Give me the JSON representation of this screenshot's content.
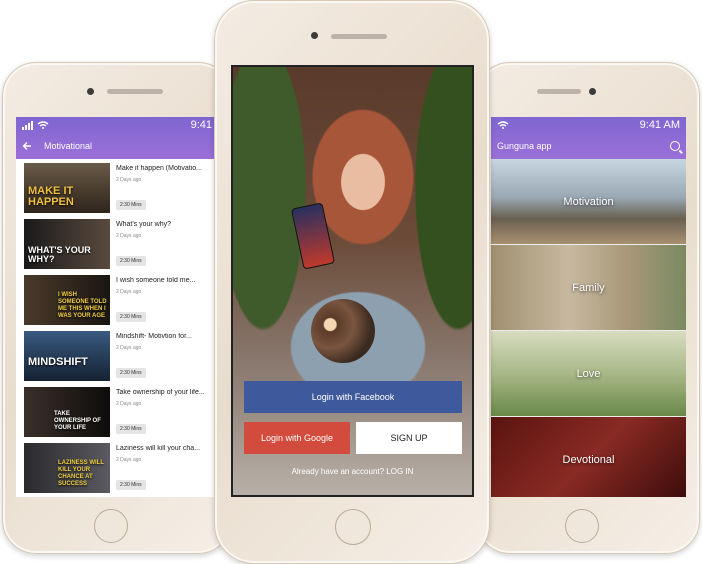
{
  "left_phone": {
    "status": {
      "time": "9:41"
    },
    "header": {
      "title": "Motivational"
    },
    "videos": [
      {
        "thumb_text": "MAKE IT HAPPEN",
        "title": "Make it happen (Motivatio...",
        "date": "2 Days ago",
        "duration": "2:30 Mins",
        "thumb_color": "#4a3a2a"
      },
      {
        "thumb_text": "WHAT'S YOUR WHY?",
        "title": "What's your why?",
        "date": "2 Days ago",
        "duration": "2:30 Mins",
        "thumb_color": "#2a2a2a"
      },
      {
        "thumb_text": "I WISH SOMEONE TOLD ME THIS WHEN I WAS YOUR AGE",
        "title": "I wish someone told me...",
        "date": "2 Days ago",
        "duration": "2:30 Mins",
        "thumb_color": "#3a2e22"
      },
      {
        "thumb_text": "MINDSHIFT",
        "title": "Mindshift- Motivtion for...",
        "date": "2 Days ago",
        "duration": "2:30 Mins",
        "thumb_color": "#1f3a5a"
      },
      {
        "thumb_text": "TAKE OWNERSHIP OF YOUR LIFE",
        "title": "Take ownership of your life...",
        "date": "2 Days ago",
        "duration": "2:30 Mins",
        "thumb_color": "#2c2420"
      },
      {
        "thumb_text": "LAZINESS WILL KILL YOUR CHANCE AT SUCCESS",
        "title": "Laziness will kill your cha...",
        "date": "2 Days ago",
        "duration": "2:30 Mins",
        "thumb_color": "#2a2a30"
      }
    ]
  },
  "center_phone": {
    "buttons": {
      "facebook": "Login with Facebook",
      "google": "Login with Google",
      "signup": "SIGN UP"
    },
    "footer": "Already have an account? LOG IN"
  },
  "right_phone": {
    "status": {
      "time": "9:41 AM"
    },
    "header": {
      "title": "Gunguna app"
    },
    "categories": [
      {
        "label": "Motivation",
        "color": "#8a9aa8"
      },
      {
        "label": "Family",
        "color": "#9a8a6a"
      },
      {
        "label": "Love",
        "color": "#8aa070"
      },
      {
        "label": "Devotional",
        "color": "#7a2a26"
      }
    ]
  },
  "colors": {
    "header_purple": "#8a6ad4",
    "facebook": "#3f5a9c",
    "google": "#d24b3c"
  }
}
